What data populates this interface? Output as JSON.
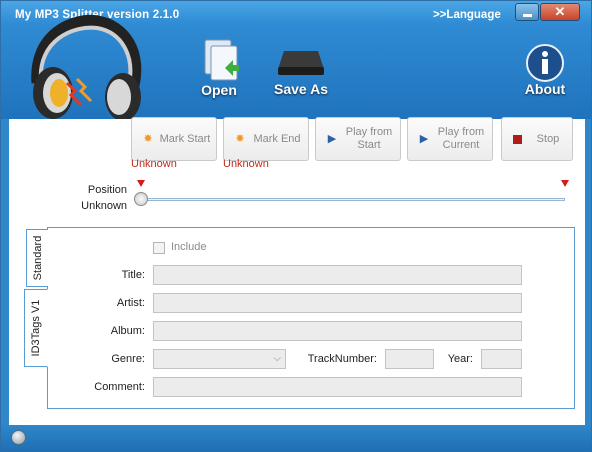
{
  "window": {
    "title": "My MP3 Splitter version 2.1.0",
    "language_link": ">>Language",
    "close_label": "✕",
    "accent_color": "#2f86c9"
  },
  "toolbar": {
    "open_label": "Open",
    "save_as_label": "Save As",
    "about_label": "About"
  },
  "actions": {
    "mark_start": "Mark Start",
    "mark_end": "Mark End",
    "play_from_start": "Play from Start",
    "play_from_current": "Play from Current",
    "stop": "Stop",
    "start_value": "Unknown",
    "end_value": "Unknown"
  },
  "position": {
    "label": "Position",
    "value": "Unknown"
  },
  "tabs": {
    "standard": "Standard",
    "id3v1": "ID3Tags V1"
  },
  "tags": {
    "include_label": "Include",
    "title_label": "Title:",
    "artist_label": "Artist:",
    "album_label": "Album:",
    "genre_label": "Genre:",
    "track_label": "TrackNumber:",
    "year_label": "Year:",
    "comment_label": "Comment:",
    "title_value": "",
    "artist_value": "",
    "album_value": "",
    "genre_value": "",
    "track_value": "",
    "year_value": "",
    "comment_value": ""
  },
  "icons": {
    "headphones": "headphones-logo-icon",
    "open": "open-document-icon",
    "save": "save-drive-icon",
    "about": "info-icon",
    "globe": "globe-icon"
  }
}
